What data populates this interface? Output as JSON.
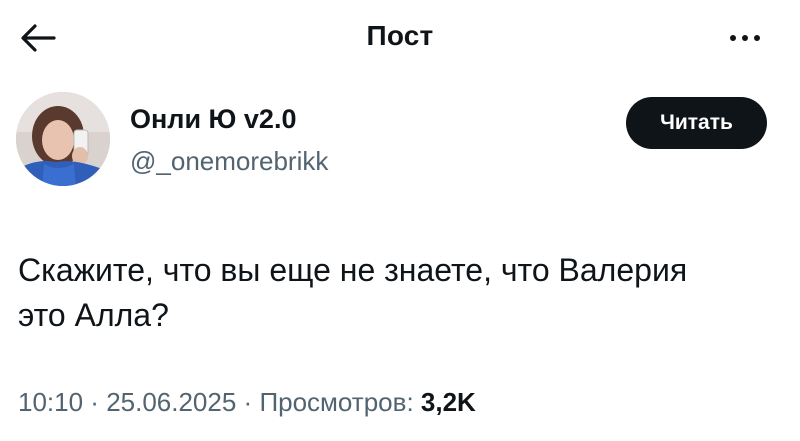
{
  "header": {
    "title": "Пост",
    "back_icon": "arrow-left-icon",
    "more_icon": "more-horizontal-icon"
  },
  "author": {
    "display_name": "Онли Ю v2.0",
    "handle": "@_onemorebrikk",
    "follow_label": "Читать"
  },
  "post": {
    "text_line1": "Скажите, что вы еще не знаете, что Валерия",
    "text_line2": "это Алла?"
  },
  "meta": {
    "time": "10:10",
    "separator": " · ",
    "date": "25.06.2025",
    "views_label": "Просмотров: ",
    "views_count": "3,2K"
  },
  "colors": {
    "text_primary": "#0f1419",
    "text_secondary": "#536471",
    "button_bg": "#0f1419",
    "button_text": "#ffffff",
    "background": "#ffffff"
  }
}
